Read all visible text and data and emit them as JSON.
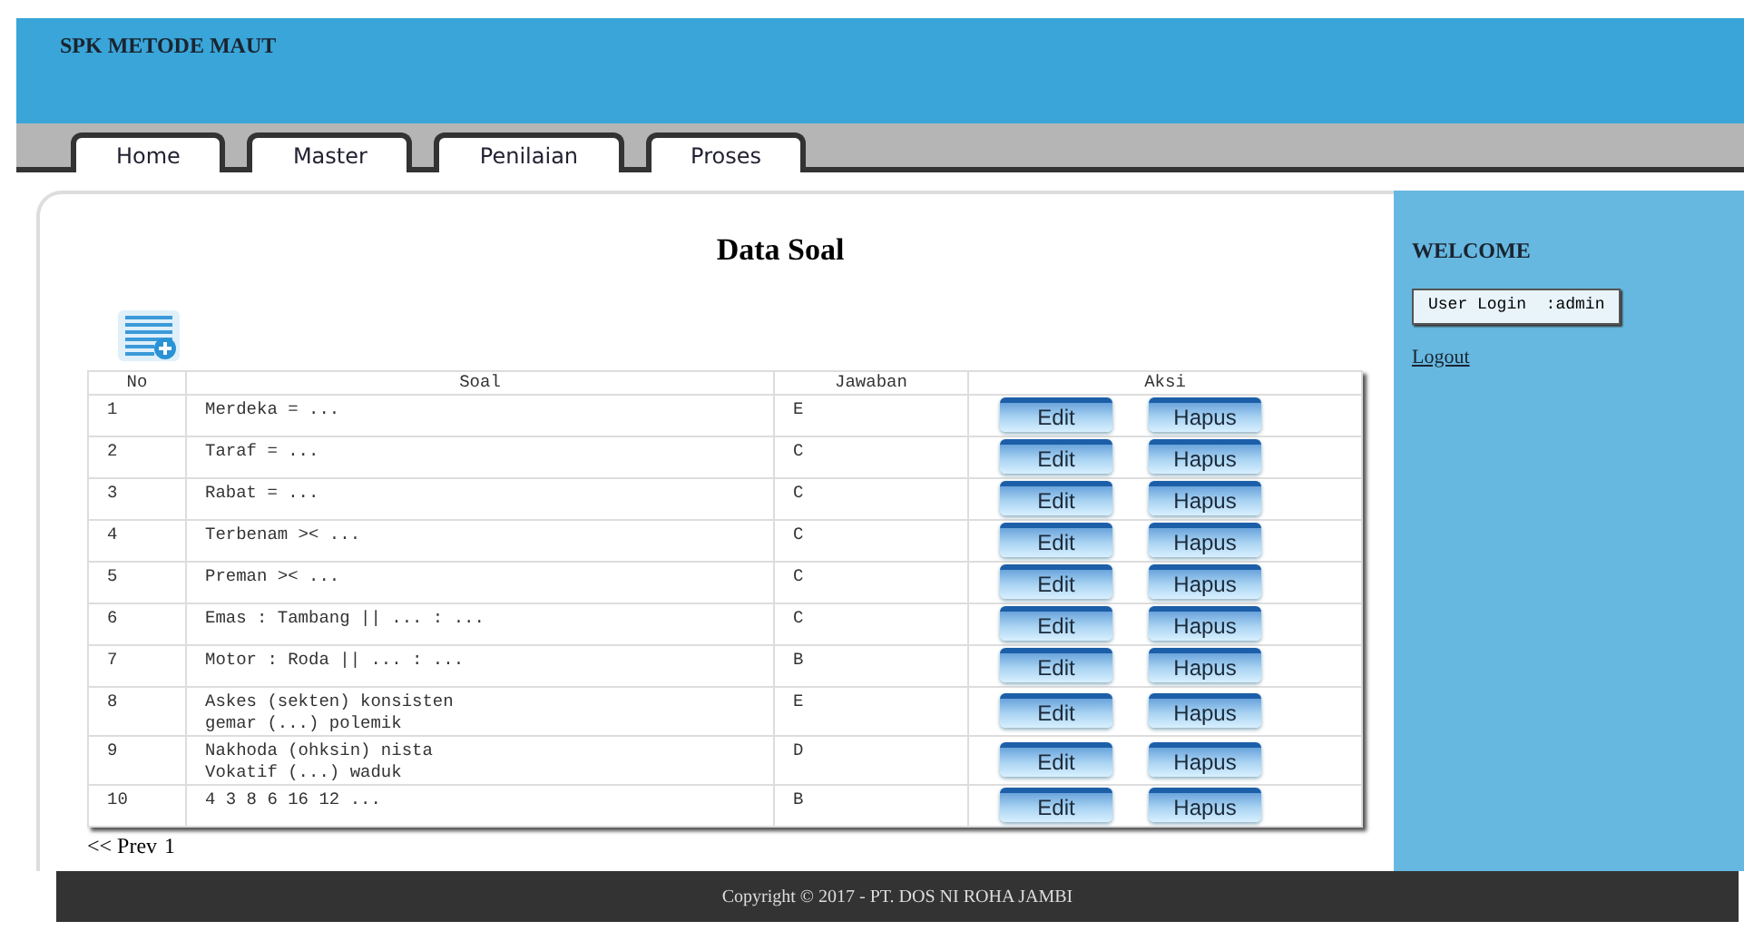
{
  "header": {
    "title": "SPK METODE MAUT"
  },
  "tabs": [
    {
      "label": "Home"
    },
    {
      "label": "Master"
    },
    {
      "label": "Penilaian"
    },
    {
      "label": "Proses"
    }
  ],
  "page_title": "Data Soal",
  "table": {
    "columns": [
      "No",
      "Soal",
      "Jawaban",
      "Aksi"
    ],
    "rows": [
      {
        "no": "1",
        "soal": [
          "Merdeka = ..."
        ],
        "jawaban": "E",
        "edit": "Edit",
        "hapus": "Hapus"
      },
      {
        "no": "2",
        "soal": [
          "Taraf = ..."
        ],
        "jawaban": "C",
        "edit": "Edit",
        "hapus": "Hapus"
      },
      {
        "no": "3",
        "soal": [
          "Rabat = ..."
        ],
        "jawaban": "C",
        "edit": "Edit",
        "hapus": "Hapus"
      },
      {
        "no": "4",
        "soal": [
          "Terbenam >< ..."
        ],
        "jawaban": "C",
        "edit": "Edit",
        "hapus": "Hapus"
      },
      {
        "no": "5",
        "soal": [
          "Preman >< ..."
        ],
        "jawaban": "C",
        "edit": "Edit",
        "hapus": "Hapus"
      },
      {
        "no": "6",
        "soal": [
          "Emas : Tambang || ... : ..."
        ],
        "jawaban": "C",
        "edit": "Edit",
        "hapus": "Hapus"
      },
      {
        "no": "7",
        "soal": [
          "Motor : Roda || ... : ..."
        ],
        "jawaban": "B",
        "edit": "Edit",
        "hapus": "Hapus"
      },
      {
        "no": "8",
        "soal": [
          "Askes (sekten) konsisten",
          "gemar (...) polemik"
        ],
        "jawaban": "E",
        "edit": "Edit",
        "hapus": "Hapus"
      },
      {
        "no": "9",
        "soal": [
          "Nakhoda (ohksin) nista",
          "Vokatif (...) waduk"
        ],
        "jawaban": "D",
        "edit": "Edit",
        "hapus": "Hapus"
      },
      {
        "no": "10",
        "soal": [
          "4 3 8 6 16 12 ..."
        ],
        "jawaban": "B",
        "edit": "Edit",
        "hapus": "Hapus"
      }
    ]
  },
  "pagination": {
    "prev": "<< Prev",
    "page": "1"
  },
  "sidebar": {
    "heading": "WELCOME",
    "user_login": "User Login  :admin",
    "logout": "Logout"
  },
  "footer": "Copyright © 2017 - PT. DOS NI ROHA JAMBI"
}
